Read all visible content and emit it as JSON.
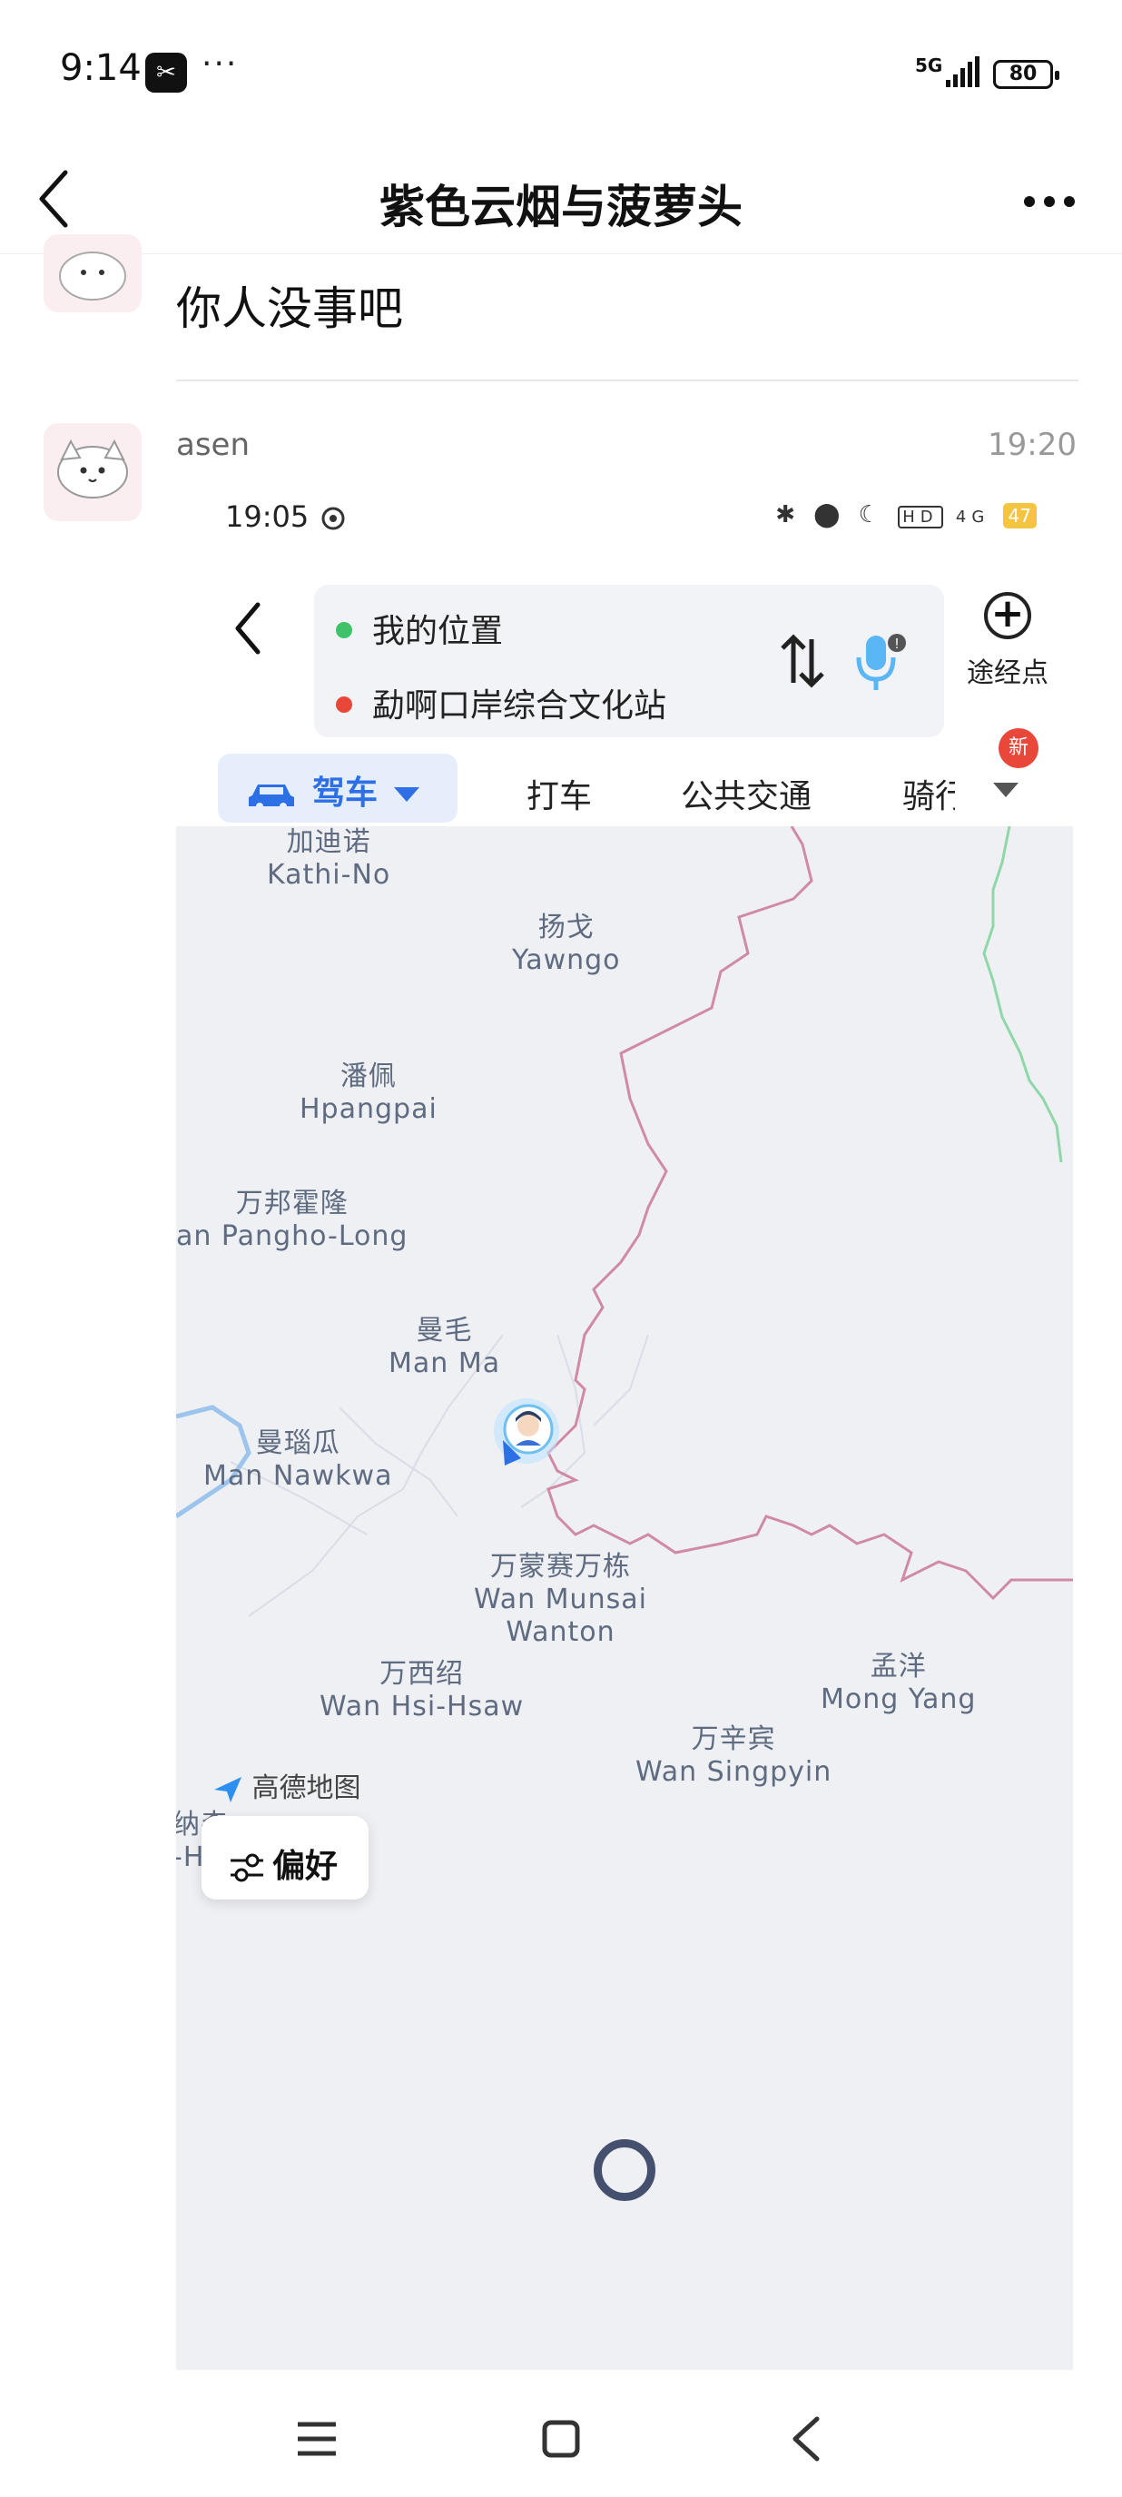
{
  "status_bar": {
    "time": "9:14",
    "capcut_glyph": "✂",
    "more_dots": "···",
    "network": "5G",
    "battery": "80"
  },
  "header": {
    "title": "紫色云烟与菠萝头"
  },
  "messages": [
    {
      "text": "你人没事吧"
    },
    {
      "sender": "asen",
      "timestamp": "19:20"
    }
  ],
  "embedded": {
    "status": {
      "time": "19:05",
      "battery": "47",
      "network": "4G",
      "hd": "HD"
    },
    "route": {
      "origin": "我的位置",
      "destination": "勐啊口岸综合文化站"
    },
    "waypoint_label": "途经点",
    "tabs": [
      {
        "label": "驾车"
      },
      {
        "label": "打车"
      },
      {
        "label": "公共交通"
      },
      {
        "label": "骑行"
      }
    ],
    "new_badge": "新",
    "map_labels": [
      {
        "zh": "加迪诺",
        "en": "Kathi-No"
      },
      {
        "zh": "扬戈",
        "en": "Yawngo"
      },
      {
        "zh": "潘佩",
        "en": "Hpangpai"
      },
      {
        "zh": "万邦霍隆",
        "en": "an Pangho-Long"
      },
      {
        "zh": "曼毛",
        "en": "Man Ma"
      },
      {
        "zh": "曼瑙瓜",
        "en": "Man Nawkwa"
      },
      {
        "zh": "万蒙赛万栋",
        "en": "Wan Munsai",
        "en2": "Wanton"
      },
      {
        "zh": "万西绍",
        "en": "Wan Hsi-Hsaw"
      },
      {
        "zh": "孟洋",
        "en": "Mong Yang"
      },
      {
        "zh": "万辛宾",
        "en": "Wan Singpyin"
      },
      {
        "zh": "纳森",
        "en": "-H"
      }
    ],
    "map_provider": "高德地图",
    "preference_button": "偏好"
  },
  "colors": {
    "accent": "#2d6fe4",
    "border_line": "#d080a0",
    "river": "#7fb3e6",
    "badge": "#e8473a"
  }
}
